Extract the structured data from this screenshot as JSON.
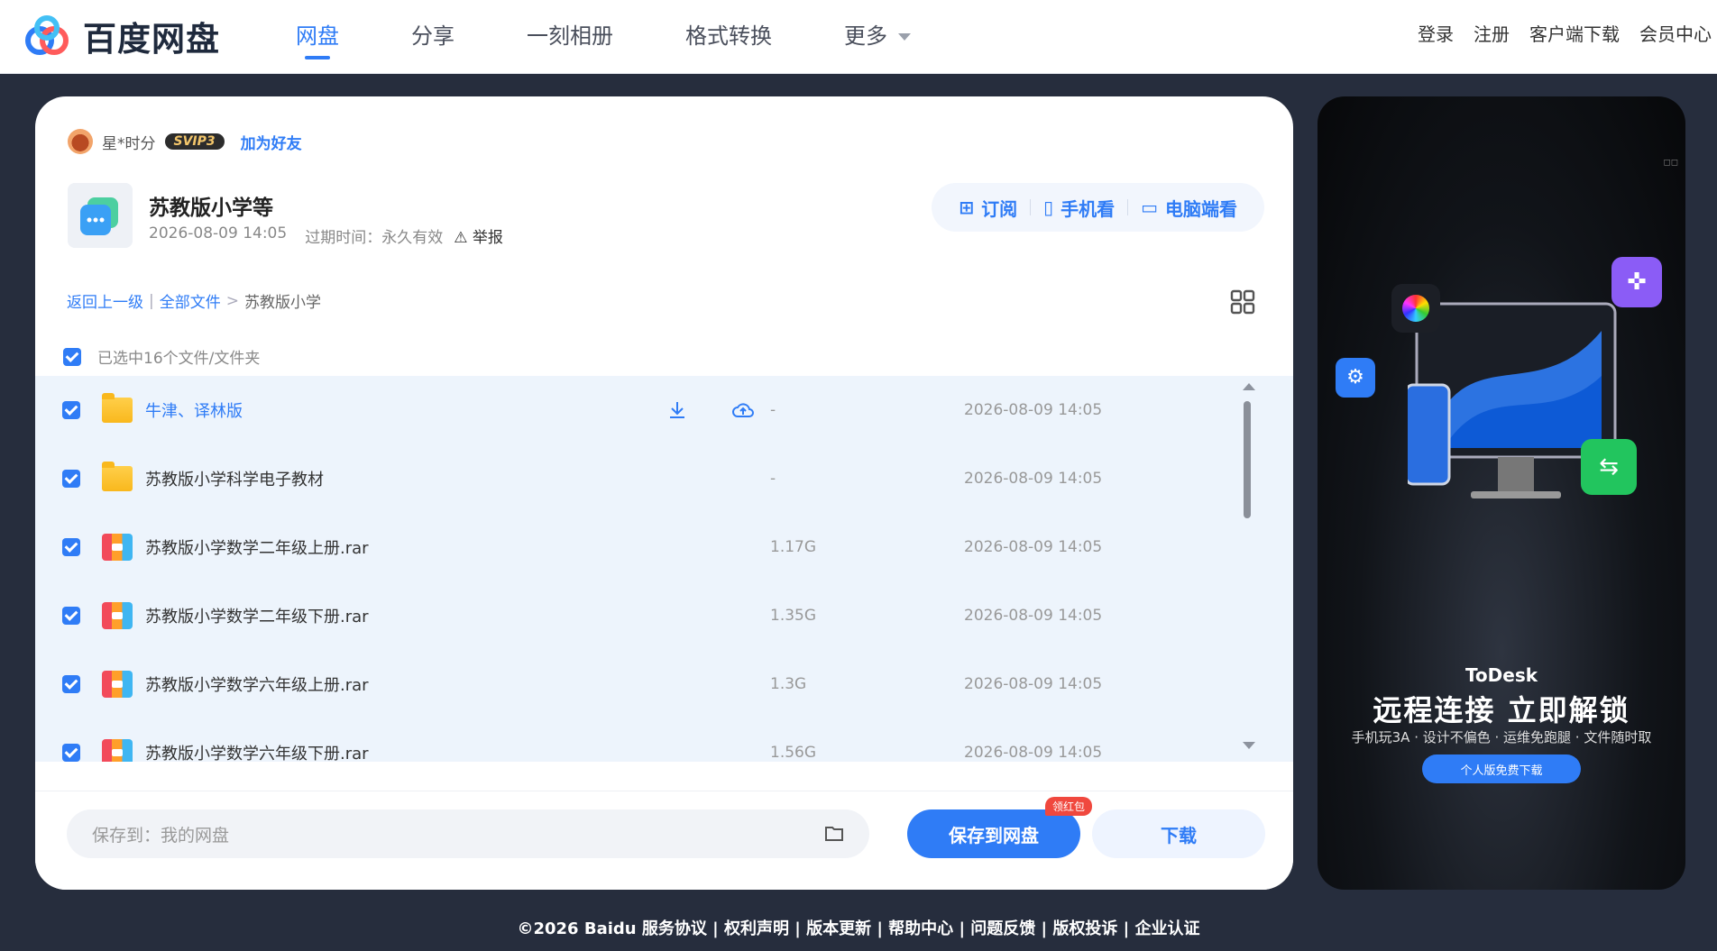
{
  "brand": {
    "name": "百度网盘"
  },
  "nav": {
    "items": [
      {
        "label": "网盘",
        "active": true
      },
      {
        "label": "分享"
      },
      {
        "label": "一刻相册"
      },
      {
        "label": "格式转换"
      },
      {
        "label": "更多"
      }
    ],
    "right_links": [
      "登录",
      "注册",
      "客户端下载",
      "会员中心"
    ]
  },
  "sharer": {
    "name": "星*时分",
    "badge": "SVIP3",
    "add_friend": "加为好友"
  },
  "share": {
    "title": "苏教版小学等",
    "created": "2026-08-09 14:05",
    "expire_label": "过期时间：永久有效",
    "report": "举报"
  },
  "view_actions": {
    "subscribe": "订阅",
    "mobile": "手机看",
    "pc": "电脑端看"
  },
  "breadcrumb": {
    "back": "返回上一级",
    "all": "全部文件",
    "sep": ">",
    "current": "苏教版小学"
  },
  "selection": {
    "label": "已选中16个文件/文件夹"
  },
  "files": [
    {
      "name": "牛津、译林版",
      "type": "folder",
      "size": "-",
      "date": "2026-08-09 14:05",
      "hover": true
    },
    {
      "name": "苏教版小学科学电子教材",
      "type": "folder",
      "size": "-",
      "date": "2026-08-09 14:05"
    },
    {
      "name": "苏教版小学数学二年级上册.rar",
      "type": "rar",
      "size": "1.17G",
      "date": "2026-08-09 14:05"
    },
    {
      "name": "苏教版小学数学二年级下册.rar",
      "type": "rar",
      "size": "1.35G",
      "date": "2026-08-09 14:05"
    },
    {
      "name": "苏教版小学数学六年级上册.rar",
      "type": "rar",
      "size": "1.3G",
      "date": "2026-08-09 14:05"
    },
    {
      "name": "苏教版小学数学六年级下册.rar",
      "type": "rar",
      "size": "1.56G",
      "date": "2026-08-09 14:05"
    }
  ],
  "save": {
    "path_label": "保存到：我的网盘",
    "save_button": "保存到网盘",
    "badge": "领红包",
    "download_button": "下载"
  },
  "ad": {
    "brand": "ToDesk",
    "headline": "远程连接 立即解锁",
    "sub": "手机玩3A · 设计不偏色 · 运维免跑腿 · 文件随时取",
    "cta": "个人版免费下载"
  },
  "footer": {
    "text": "©2026 Baidu 服务协议 | 权利声明 | 版本更新 | 帮助中心 | 问题反馈 | 版权投诉 | 企业认证"
  },
  "colors": {
    "accent": "#2f7cf6",
    "page_bg": "#262d3d",
    "list_bg": "#edf4fc"
  }
}
